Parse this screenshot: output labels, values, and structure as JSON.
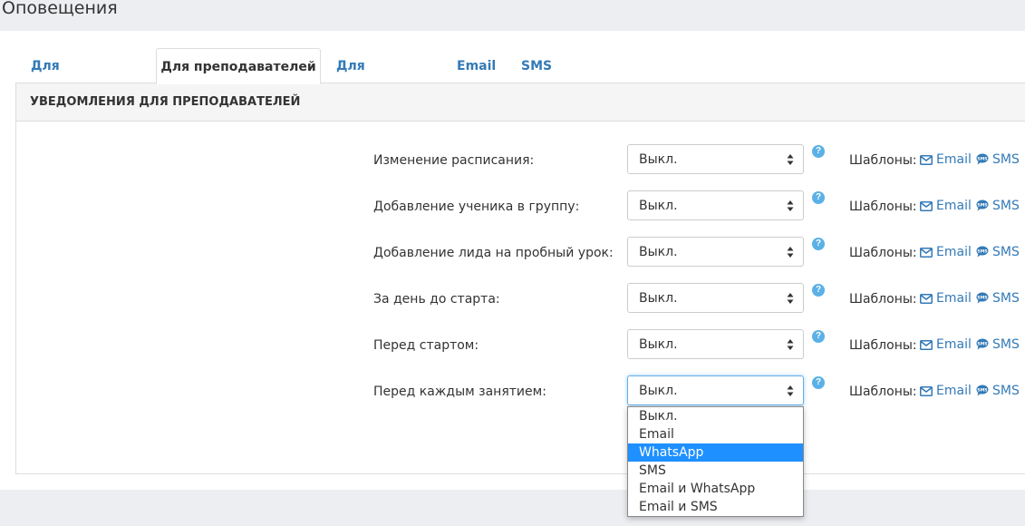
{
  "page": {
    "title": "Оповещения"
  },
  "tabs": [
    {
      "label": "Для сотрудников"
    },
    {
      "label": "Для преподавателей"
    },
    {
      "label": "Для учеников"
    },
    {
      "label": "Email"
    },
    {
      "label": "SMS"
    }
  ],
  "panel": {
    "heading": "УВЕДОМЛЕНИЯ ДЛЯ ПРЕПОДАВАТЕЛЕЙ"
  },
  "rows": [
    {
      "label": "Изменение расписания:",
      "value": "Выкл.",
      "help": "?",
      "templates_label": "Шаблоны:",
      "email": "Email",
      "sms": "SMS"
    },
    {
      "label": "Добавление ученика в группу:",
      "value": "Выкл.",
      "help": "?",
      "templates_label": "Шаблоны:",
      "email": "Email",
      "sms": "SMS"
    },
    {
      "label": "Добавление лида на пробный урок:",
      "value": "Выкл.",
      "help": "?",
      "templates_label": "Шаблоны:",
      "email": "Email",
      "sms": "SMS"
    },
    {
      "label": "За день до старта:",
      "value": "Выкл.",
      "help": "?",
      "templates_label": "Шаблоны:",
      "email": "Email",
      "sms": "SMS"
    },
    {
      "label": "Перед стартом:",
      "value": "Выкл.",
      "help": "?",
      "templates_label": "Шаблоны:",
      "email": "Email",
      "sms": "SMS"
    },
    {
      "label": "Перед каждым занятием:",
      "value": "Выкл.",
      "help": "?",
      "templates_label": "Шаблоны:",
      "email": "Email",
      "sms": "SMS"
    }
  ],
  "dropdown": {
    "options": [
      "Выкл.",
      "Email",
      "WhatsApp",
      "SMS",
      "Email и WhatsApp",
      "Email и SMS"
    ],
    "highlighted": "WhatsApp"
  },
  "colors": {
    "link": "#337ab7",
    "highlight": "#1e90ff",
    "help": "#5bb1e6"
  },
  "icons": {
    "select": "updown-caret-icon",
    "help": "question-circle-icon",
    "email": "envelope-icon",
    "sms": "sms-bubble-icon"
  }
}
